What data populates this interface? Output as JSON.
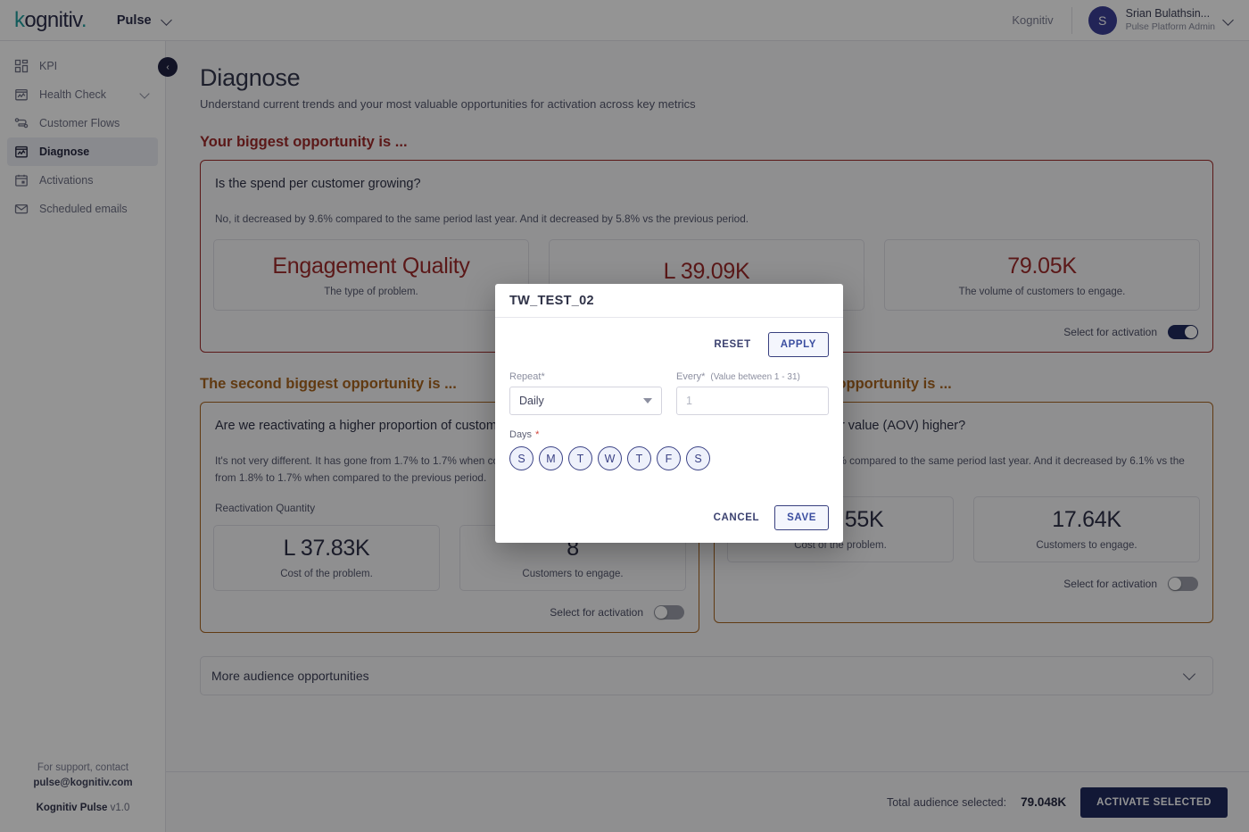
{
  "topbar": {
    "logo_text": "kognitiv",
    "app_name": "Pulse",
    "tenant": "Kognitiv",
    "avatar_initial": "S",
    "user_name": "Srian Bulathsin...",
    "user_role": "Pulse Platform Admin"
  },
  "sidebar": {
    "items": [
      {
        "label": "KPI",
        "icon": "grid-icon",
        "active": false,
        "expandable": false
      },
      {
        "label": "Health Check",
        "icon": "chart-clipboard-icon",
        "active": false,
        "expandable": true
      },
      {
        "label": "Customer Flows",
        "icon": "flow-icon",
        "active": false,
        "expandable": false
      },
      {
        "label": "Diagnose",
        "icon": "chart-clipboard-icon",
        "active": true,
        "expandable": false
      },
      {
        "label": "Activations",
        "icon": "calendar-icon",
        "active": false,
        "expandable": false
      },
      {
        "label": "Scheduled emails",
        "icon": "mail-icon",
        "active": false,
        "expandable": false
      }
    ],
    "collapse_icon": "chevron-left-icon",
    "footer": {
      "support_line": "For support, contact",
      "support_email": "pulse@kognitiv.com",
      "product": "Kognitiv Pulse",
      "version": "v1.0"
    }
  },
  "page": {
    "title": "Diagnose",
    "subtitle": "Understand current trends and your most valuable opportunities for activation across key metrics"
  },
  "opportunity_1": {
    "heading": "Your biggest opportunity is ...",
    "question": "Is the spend per customer growing?",
    "answer": "No, it decreased by 9.6% compared to the same period last year. And it decreased by 5.8% vs the previous period.",
    "metrics": [
      {
        "value": "Engagement Quality",
        "caption": "The type of problem."
      },
      {
        "value": "L 39.09K",
        "caption": ""
      },
      {
        "value": "79.05K",
        "caption": "The volume of customers to engage."
      }
    ],
    "activation_label": "Select for activation",
    "activation_on": true,
    "accent": "#9e2a2a"
  },
  "opportunity_2": {
    "heading": "The second biggest opportunity is ...",
    "question": "Are we reactivating a higher proportion of customers in this segment?",
    "answer": "It's not very different. It has gone from 1.7% to 1.7% when compared to last year. And it has gone from 1.8% to 1.7% when compared to the previous period.",
    "sub_label": "Reactivation Quantity",
    "metrics": [
      {
        "value": "L 37.83K",
        "caption": "Cost of the problem."
      },
      {
        "value": "8",
        "caption": "Customers to engage."
      }
    ],
    "activation_label": "Select for activation",
    "activation_on": false,
    "accent": "#a8651f"
  },
  "opportunity_3": {
    "heading": "The third biggest opportunity is ...",
    "question": "Is the average order value (AOV) higher?",
    "answer": "No, it decreased by 4.8% compared to the same period last year. And it decreased by 6.1% vs the previous period.",
    "metrics": [
      {
        "value": "L 37.55K",
        "caption": "Cost of the problem."
      },
      {
        "value": "17.64K",
        "caption": "Customers to engage."
      }
    ],
    "activation_label": "Select for activation",
    "activation_on": false,
    "accent": "#a8651f"
  },
  "more_bar": {
    "label": "More audience opportunities",
    "icon": "chevron-down-icon"
  },
  "footer_bar": {
    "total_label": "Total audience selected:",
    "total_value": "79.048K",
    "activate_label": "ACTIVATE SELECTED"
  },
  "modal": {
    "title": "TW_TEST_02",
    "reset_label": "RESET",
    "apply_label": "APPLY",
    "repeat_label": "Repeat*",
    "repeat_value": "Daily",
    "every_label": "Every*",
    "every_hint": "(Value between 1 - 31)",
    "every_placeholder": "1",
    "every_value": "",
    "days_label": "Days",
    "days_required": "*",
    "days": [
      "S",
      "M",
      "T",
      "W",
      "T",
      "F",
      "S"
    ],
    "cancel_label": "CANCEL",
    "save_label": "SAVE"
  }
}
